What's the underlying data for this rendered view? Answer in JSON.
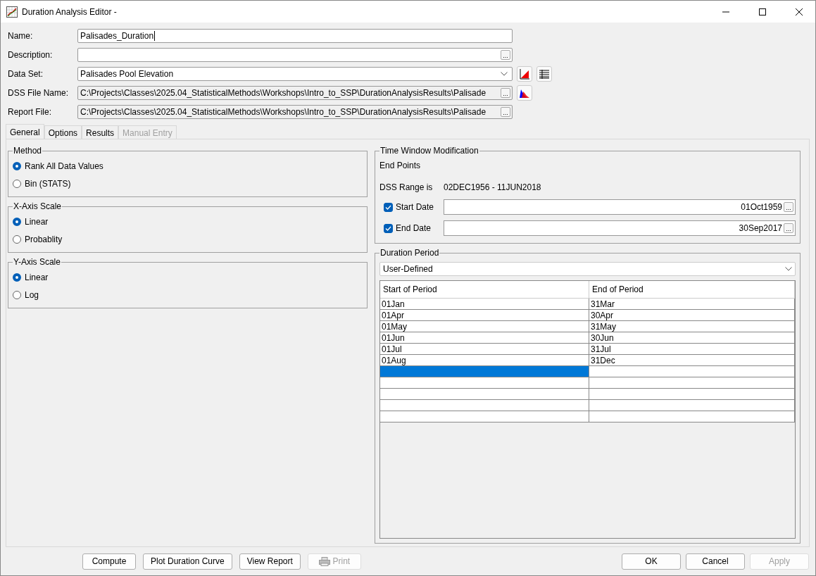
{
  "window": {
    "title": "Duration Analysis Editor -"
  },
  "fields": [
    {
      "label": "Name:",
      "kind": "text",
      "value": "Palisades_Duration",
      "focused": true
    },
    {
      "label": "Description:",
      "kind": "browse"
    },
    {
      "label": "Data Set:",
      "kind": "combo",
      "value": "Palisades Pool Elevation"
    },
    {
      "label": "DSS File Name:",
      "kind": "browse",
      "value": "C:\\Projects\\Classes\\2025.04_StatisticalMethods\\Workshops\\Intro_to_SSP\\DurationAnalysisResults\\Palisade",
      "disabled": true
    },
    {
      "label": "Report File:",
      "kind": "browse",
      "value": "C:\\Projects\\Classes\\2025.04_StatisticalMethods\\Workshops\\Intro_to_SSP\\DurationAnalysisResults\\Palisade",
      "disabled": true
    }
  ],
  "tabs": [
    {
      "label": "General",
      "selected": true,
      "disabled": false
    },
    {
      "label": "Options",
      "selected": false,
      "disabled": false
    },
    {
      "label": "Results",
      "selected": false,
      "disabled": false
    },
    {
      "label": "Manual Entry",
      "selected": false,
      "disabled": true
    }
  ],
  "groups": [
    {
      "title": "Method",
      "options": [
        {
          "label": "Rank All Data Values",
          "selected": true
        },
        {
          "label": "Bin (STATS)",
          "selected": false
        }
      ]
    },
    {
      "title": "X-Axis Scale",
      "options": [
        {
          "label": "Linear",
          "selected": true
        },
        {
          "label": "Probablity",
          "selected": false
        }
      ]
    },
    {
      "title": "Y-Axis Scale",
      "options": [
        {
          "label": "Linear",
          "selected": true
        },
        {
          "label": "Log",
          "selected": false
        }
      ]
    }
  ],
  "time_window": {
    "title": "Time Window Modification",
    "subtitle": "End Points",
    "range_label": "DSS Range is",
    "range": "02DEC1956 - 11JUN2018",
    "dates": [
      {
        "label": "Start Date",
        "checked": true,
        "value": "01Oct1959"
      },
      {
        "label": "End Date",
        "checked": true,
        "value": "30Sep2017"
      }
    ]
  },
  "duration_period": {
    "title": "Duration Period",
    "mode": "User-Defined",
    "columns": [
      "Start of Period",
      "End of Period"
    ],
    "rows": [
      {
        "cells": [
          "01Jan",
          "31Mar"
        ],
        "selected": false
      },
      {
        "cells": [
          "01Apr",
          "30Apr"
        ],
        "selected": false
      },
      {
        "cells": [
          "01May",
          "31May"
        ],
        "selected": false
      },
      {
        "cells": [
          "01Jun",
          "30Jun"
        ],
        "selected": false
      },
      {
        "cells": [
          "01Jul",
          "31Jul"
        ],
        "selected": false
      },
      {
        "cells": [
          "01Aug",
          "31Dec"
        ],
        "selected": false
      }
    ],
    "blank_rows": [
      {
        "selected": true
      },
      {
        "selected": false
      },
      {
        "selected": false
      },
      {
        "selected": false
      },
      {
        "selected": false
      }
    ]
  },
  "left_buttons": [
    {
      "label": "Compute",
      "disabled": false
    },
    {
      "label": "Plot Duration Curve",
      "disabled": false
    },
    {
      "label": "View Report",
      "disabled": false
    },
    {
      "label": "Print",
      "disabled": true,
      "kind": "print"
    }
  ],
  "browse_label": "...",
  "right_buttons": [
    {
      "label": "OK",
      "disabled": false
    },
    {
      "label": "Cancel",
      "disabled": false
    },
    {
      "label": "Apply",
      "disabled": true
    }
  ]
}
